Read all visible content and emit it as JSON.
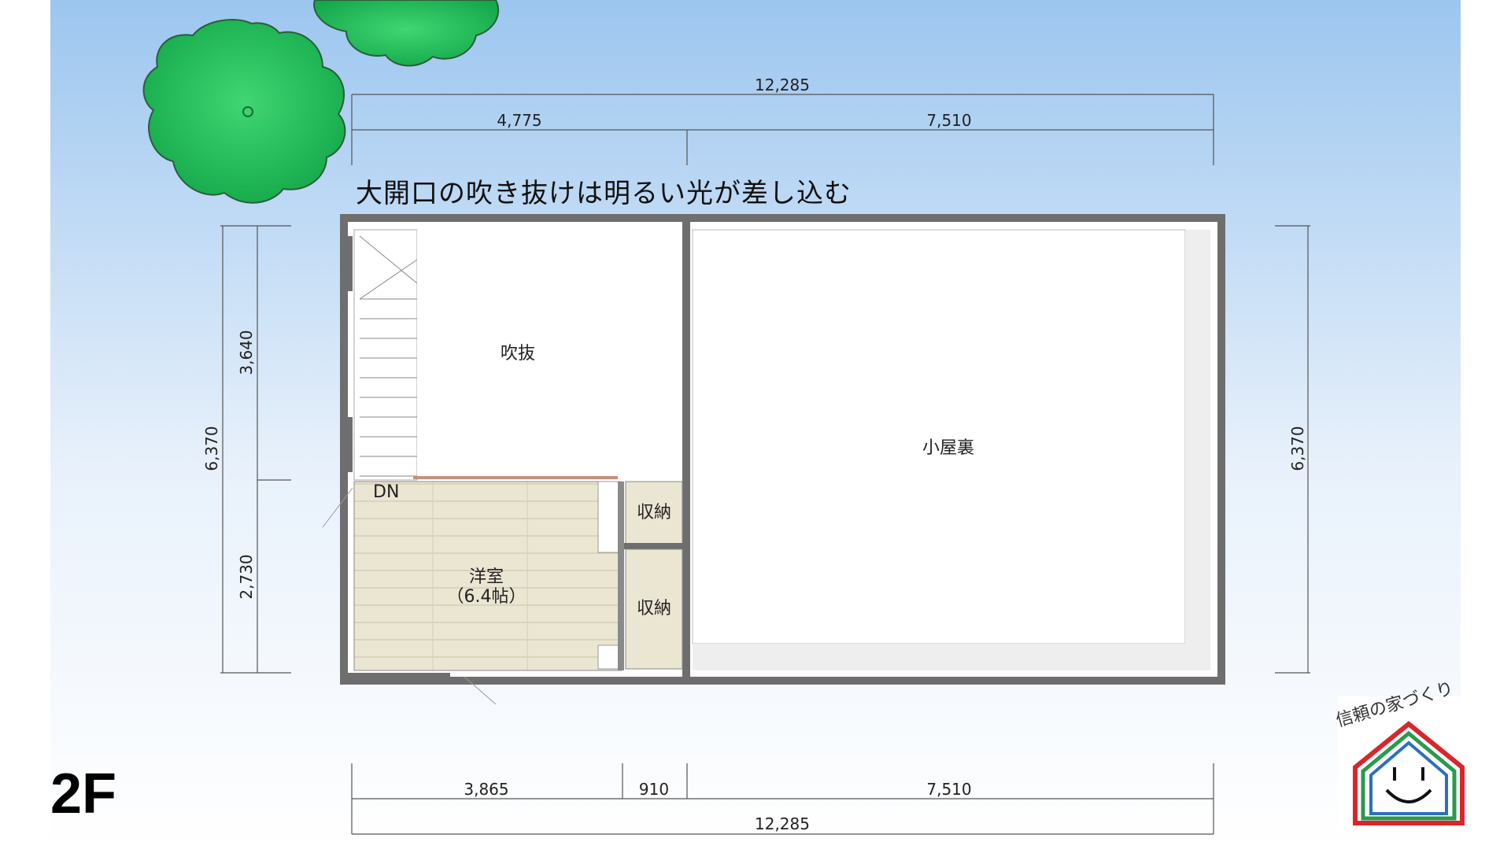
{
  "caption": "大開口の吹き抜けは明るい光が差し込む",
  "floor_label": "2F",
  "logo_text": "信頼の家づくり",
  "rooms": {
    "fukinuke": "吹抜",
    "koyaura": "小屋裏",
    "youshitsu": "洋室",
    "youshitsu_size": "（6.4帖）",
    "shuno1": "収納",
    "shuno2": "収納",
    "stair_dn": "DN"
  },
  "dimensions": {
    "top_total": "12,285",
    "top_left": "4,775",
    "top_right": "7,510",
    "bottom_left": "3,865",
    "bottom_mid": "910",
    "bottom_right": "7,510",
    "bottom_total": "12,285",
    "left_total": "6,370",
    "left_upper": "3,640",
    "left_lower": "2,730",
    "right_total": "6,370"
  },
  "colors": {
    "sky_top": "#9cc6ef",
    "sky_bottom": "#ffffff",
    "tree_green": "#1fc35a",
    "wall": "#6e6e6e",
    "floor_wood": "#e9e4cf",
    "logo_red": "#d8262c",
    "logo_blue": "#2a6fc0",
    "logo_green": "#2a9a4c"
  }
}
